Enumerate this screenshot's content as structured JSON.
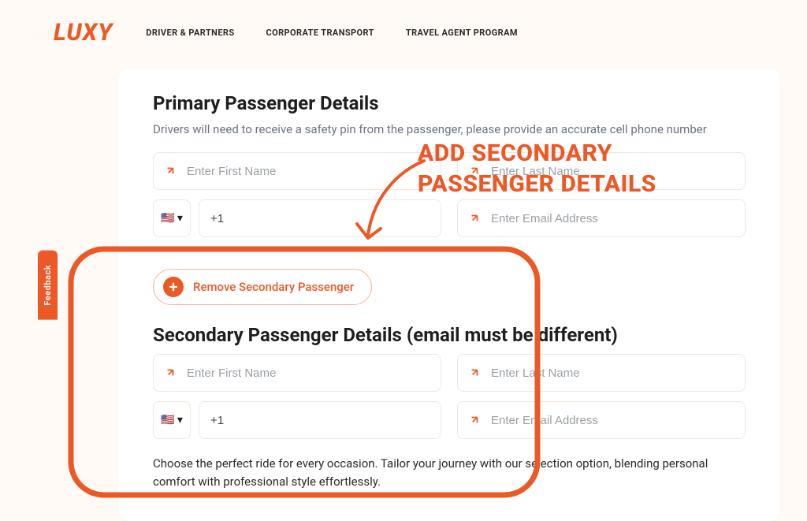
{
  "header": {
    "logo": "LUXY",
    "nav": [
      "DRIVER & PARTNERS",
      "CORPORATE TRANSPORT",
      "TRAVEL AGENT PROGRAM"
    ]
  },
  "feedback": {
    "label": "Feedback"
  },
  "annotation": {
    "headline": "ADD SECONDARY PASSENGER DETAILS"
  },
  "primary": {
    "title": "Primary Passenger Details",
    "subtitle": "Drivers will need to receive a safety pin from the passenger, please provide an accurate cell phone number",
    "first_ph": "Enter First Name",
    "last_ph": "Enter Last Name",
    "phone_prefix": "+1",
    "flag": "🇺🇸 ▾",
    "email_ph": "Enter Email Address"
  },
  "remove_btn": {
    "label": "Remove Secondary Passenger"
  },
  "secondary": {
    "title": "Secondary Passenger Details (email must be different)",
    "first_ph": "Enter First Name",
    "last_ph": "Enter Last Name",
    "phone_prefix": "+1",
    "flag": "🇺🇸 ▾",
    "email_ph": "Enter Email Address"
  },
  "footnote": "Choose the perfect ride for every occasion. Tailor your journey with our selection option, blending personal comfort with professional style effortlessly."
}
